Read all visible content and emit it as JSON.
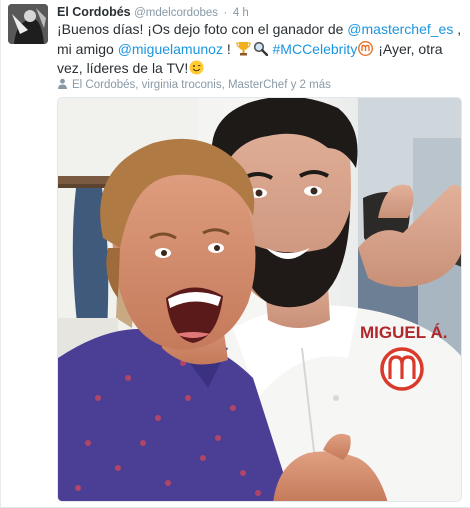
{
  "tweet": {
    "fullname": "El Cordobés",
    "handle": "@mdelcordobes",
    "separator": "·",
    "time": "4 h",
    "text_parts": {
      "p1": "¡Buenos días! ¡Os dejo foto con el ganador de ",
      "mention1": "@masterchef_es",
      "p2": " , mi amigo ",
      "mention2": "@miguelamunoz",
      "p3": " ! ",
      "hashtag": "#MCCelebrity",
      "p4": " ¡Ayer, otra vez, líderes de la TV!"
    },
    "tagged_people": "El Cordobés, virginia troconis, MasterChef y 2 más",
    "photo": {
      "chef_jacket_name": "MIGUEL Á."
    },
    "icons": [
      "avatar",
      "trophy-emoji",
      "magnifier-emoji",
      "masterchef-logo-emoji",
      "wink-emoji",
      "person-icon"
    ]
  },
  "colors": {
    "link": "#1b95e0",
    "text": "#292f33",
    "secondary": "#8899a6",
    "masterchef_red": "#d93a2b"
  }
}
